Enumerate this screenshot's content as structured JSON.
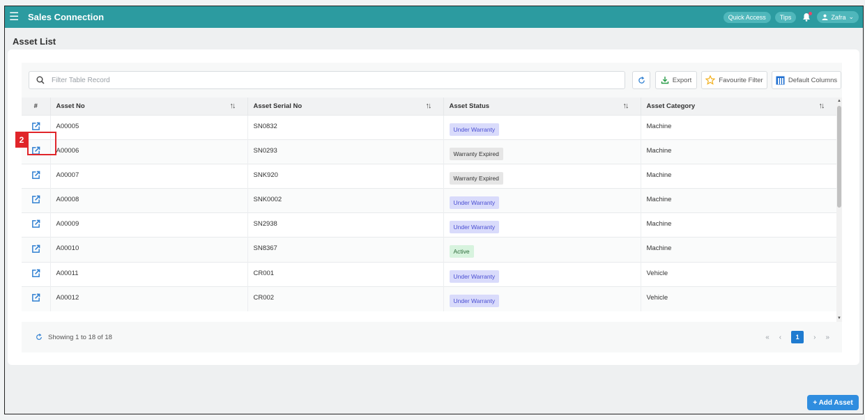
{
  "header": {
    "app_title": "Sales Connection",
    "quick_access": "Quick Access",
    "tips": "Tips",
    "user_name": "Zafra"
  },
  "page": {
    "title": "Asset List"
  },
  "toolbar": {
    "search_placeholder": "Filter Table Record",
    "export_label": "Export",
    "favourite_label": "Favourite Filter",
    "default_columns_label": "Default Columns"
  },
  "table": {
    "columns": [
      "#",
      "Asset No",
      "Asset Serial No",
      "Asset Status",
      "Asset Category"
    ],
    "rows": [
      {
        "asset_no": "A00005",
        "serial": "SN0832",
        "status": "Under Warranty",
        "category": "Machine"
      },
      {
        "asset_no": "A00006",
        "serial": "SN0293",
        "status": "Warranty Expired",
        "category": "Machine"
      },
      {
        "asset_no": "A00007",
        "serial": "SNK920",
        "status": "Warranty Expired",
        "category": "Machine"
      },
      {
        "asset_no": "A00008",
        "serial": "SNK0002",
        "status": "Under Warranty",
        "category": "Machine"
      },
      {
        "asset_no": "A00009",
        "serial": "SN2938",
        "status": "Under Warranty",
        "category": "Machine"
      },
      {
        "asset_no": "A00010",
        "serial": "SN8367",
        "status": "Active",
        "category": "Machine"
      },
      {
        "asset_no": "A00011",
        "serial": "CR001",
        "status": "Under Warranty",
        "category": "Vehicle"
      },
      {
        "asset_no": "A00012",
        "serial": "CR002",
        "status": "Under Warranty",
        "category": "Vehicle"
      }
    ]
  },
  "annotation": {
    "step_number": "2"
  },
  "footer": {
    "showing_text": "Showing 1 to 18 of 18",
    "current_page": "1"
  },
  "actions": {
    "add_asset": "+ Add Asset"
  },
  "colors": {
    "header_bg": "#2c9ba0",
    "accent_blue": "#1f7bd0",
    "highlight_red": "#e0252a"
  }
}
